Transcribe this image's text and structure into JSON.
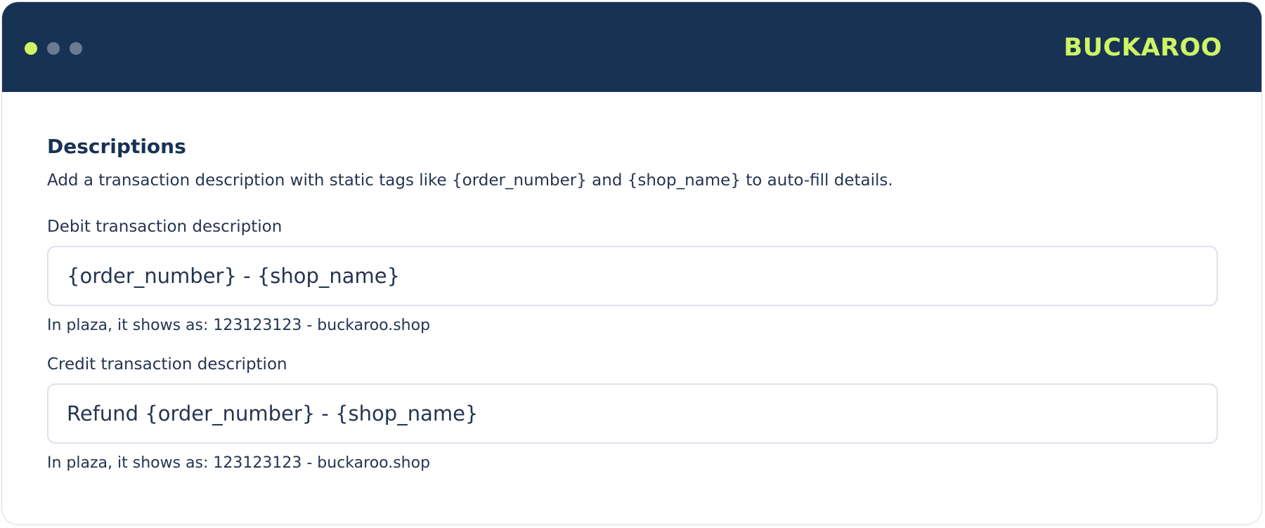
{
  "titlebar": {
    "logo_text": "BUCKAROO",
    "dot_colors": [
      "#cdf564",
      "#6b7c92",
      "#6b7c92"
    ],
    "background": "#183254",
    "accent": "#cdf564"
  },
  "section": {
    "title": "Descriptions",
    "description": "Add a transaction description with static tags like {order_number} and {shop_name} to auto-fill details."
  },
  "fields": [
    {
      "label": "Debit transaction description",
      "value": "{order_number} - {shop_name}",
      "hint": "In plaza, it shows as: 123123123 - buckaroo.shop"
    },
    {
      "label": "Credit transaction description",
      "value": "Refund {order_number} - {shop_name}",
      "hint": "In plaza, it shows as: 123123123 - buckaroo.shop"
    }
  ]
}
